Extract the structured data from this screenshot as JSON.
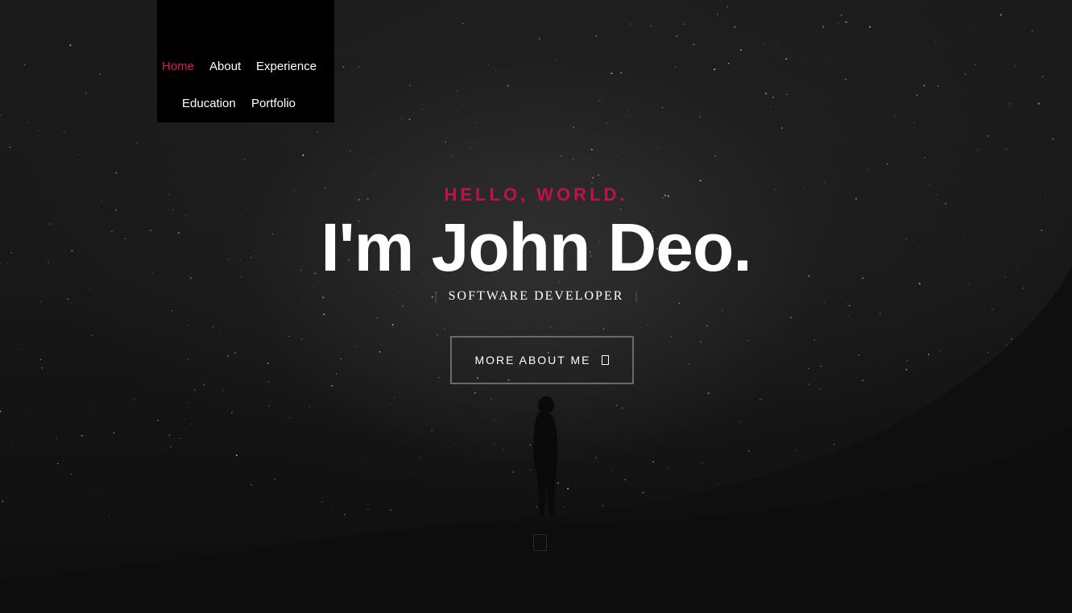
{
  "nav": {
    "items": [
      {
        "label": "Home",
        "active": true
      },
      {
        "label": "About",
        "active": false
      },
      {
        "label": "Experience",
        "active": false
      },
      {
        "label": "Education",
        "active": false
      },
      {
        "label": "Portfolio",
        "active": false
      }
    ]
  },
  "hero": {
    "greeting": "HELLO, WORLD.",
    "name": "I'm John Deo.",
    "role_bar_left": "|",
    "role": "SOFTWARE DEVELOPER",
    "role_bar_right": "|",
    "cta_label": "MORE ABOUT ME"
  },
  "icons": {
    "cta_icon": "arrow-icon",
    "scroll_icon": "scroll-down-icon"
  },
  "colors": {
    "accent": "#e0195a",
    "greeting": "#c0104f",
    "background": "#111111",
    "nav_background": "#000000"
  }
}
